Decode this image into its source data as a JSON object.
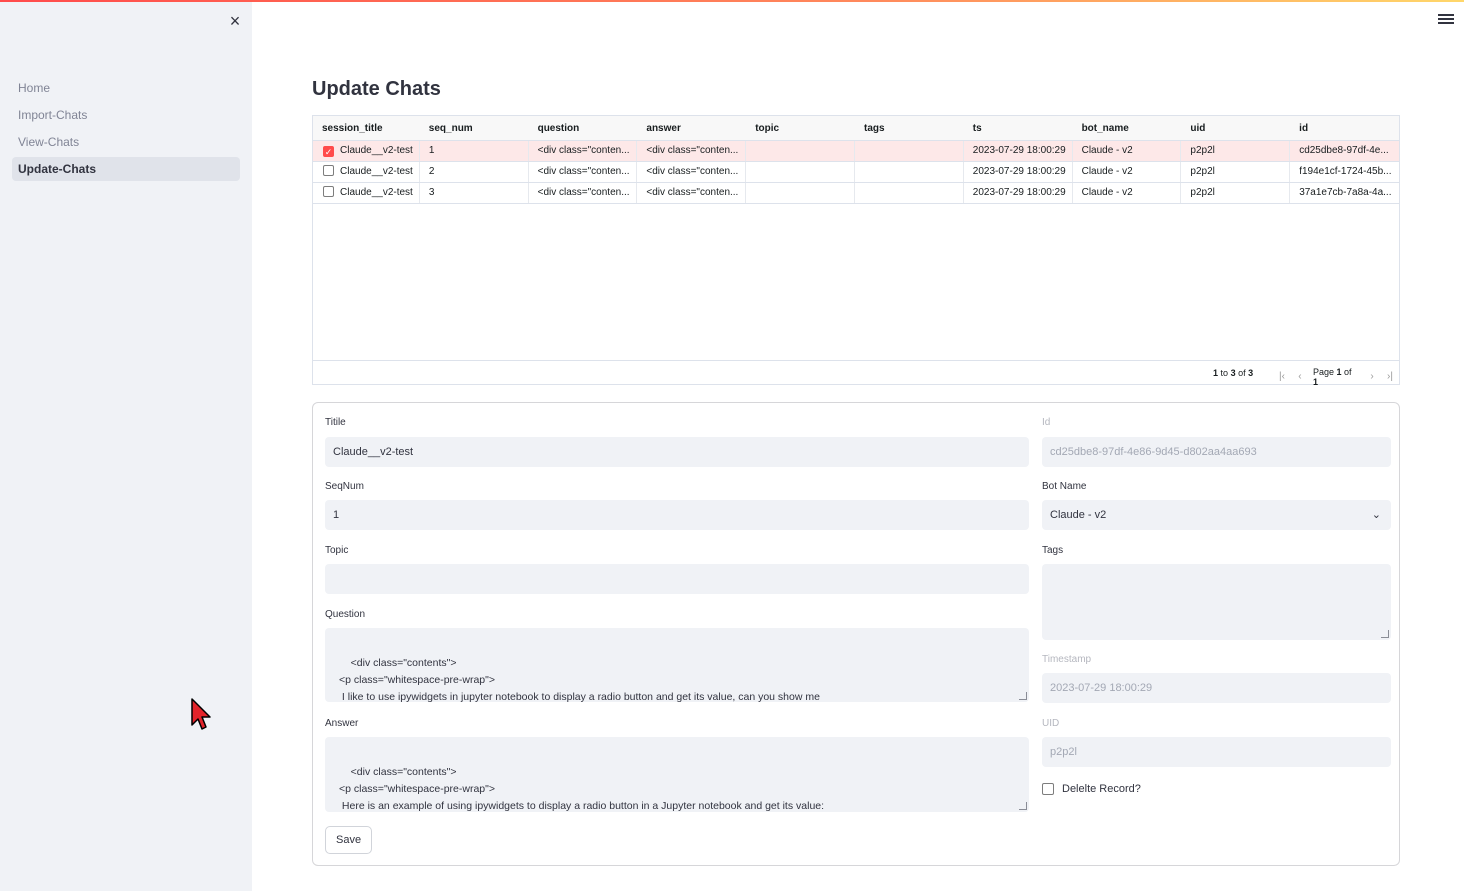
{
  "app": {
    "close_glyph": "×",
    "accent": "#ff4b4b"
  },
  "sidebar": {
    "items": [
      {
        "label": "Home"
      },
      {
        "label": "Import-Chats"
      },
      {
        "label": "View-Chats"
      },
      {
        "label": "Update-Chats",
        "active": true
      }
    ]
  },
  "page": {
    "title": "Update Chats"
  },
  "grid": {
    "columns": [
      "session_title",
      "seq_num",
      "question",
      "answer",
      "topic",
      "tags",
      "ts",
      "bot_name",
      "uid",
      "id"
    ],
    "rows": [
      {
        "selected": true,
        "cells": [
          "Claude__v2-test",
          "1",
          "<div class=\"conten...",
          "<div class=\"conten...",
          "",
          "",
          "2023-07-29 18:00:29",
          "Claude - v2",
          "p2p2l",
          "cd25dbe8-97df-4e..."
        ]
      },
      {
        "selected": false,
        "cells": [
          "Claude__v2-test",
          "2",
          "<div class=\"conten...",
          "<div class=\"conten...",
          "",
          "",
          "2023-07-29 18:00:29",
          "Claude - v2",
          "p2p2l",
          "f194e1cf-1724-45b..."
        ]
      },
      {
        "selected": false,
        "cells": [
          "Claude__v2-test",
          "3",
          "<div class=\"conten...",
          "<div class=\"conten...",
          "",
          "",
          "2023-07-29 18:00:29",
          "Claude - v2",
          "p2p2l",
          "37a1e7cb-7a8a-4a..."
        ]
      }
    ],
    "footer": {
      "summary_from": "1",
      "summary_to_word": "to",
      "summary_to": "3",
      "summary_of_word": "of",
      "summary_total": "3",
      "page_word": "Page",
      "page_current": "1",
      "page_of_word": "of",
      "page_total": "1"
    }
  },
  "form": {
    "title_label": "Titile",
    "title_value": "Claude__v2-test",
    "id_label": "Id",
    "id_value": "cd25dbe8-97df-4e86-9d45-d802aa4aa693",
    "seqnum_label": "SeqNum",
    "seqnum_value": "1",
    "botname_label": "Bot Name",
    "botname_value": "Claude - v2",
    "topic_label": "Topic",
    "topic_value": "",
    "tags_label": "Tags",
    "tags_value": "",
    "question_label": "Question",
    "question_value": "<div class=\"contents\">\n<p class=\"whitespace-pre-wrap\">\n I like to use ipywidgets in jupyter notebook to display a radio button and get its value, can you show me\n</p>",
    "timestamp_label": "Timestamp",
    "timestamp_value": "2023-07-29 18:00:29",
    "answer_label": "Answer",
    "answer_value": "<div class=\"contents\">\n<p class=\"whitespace-pre-wrap\">\n Here is an example of using ipywidgets to display a radio button in a Jupyter notebook and get its value:\n</p>",
    "uid_label": "UID",
    "uid_value": "p2p2l",
    "delete_label": "Delelte Record?",
    "save_label": "Save"
  }
}
